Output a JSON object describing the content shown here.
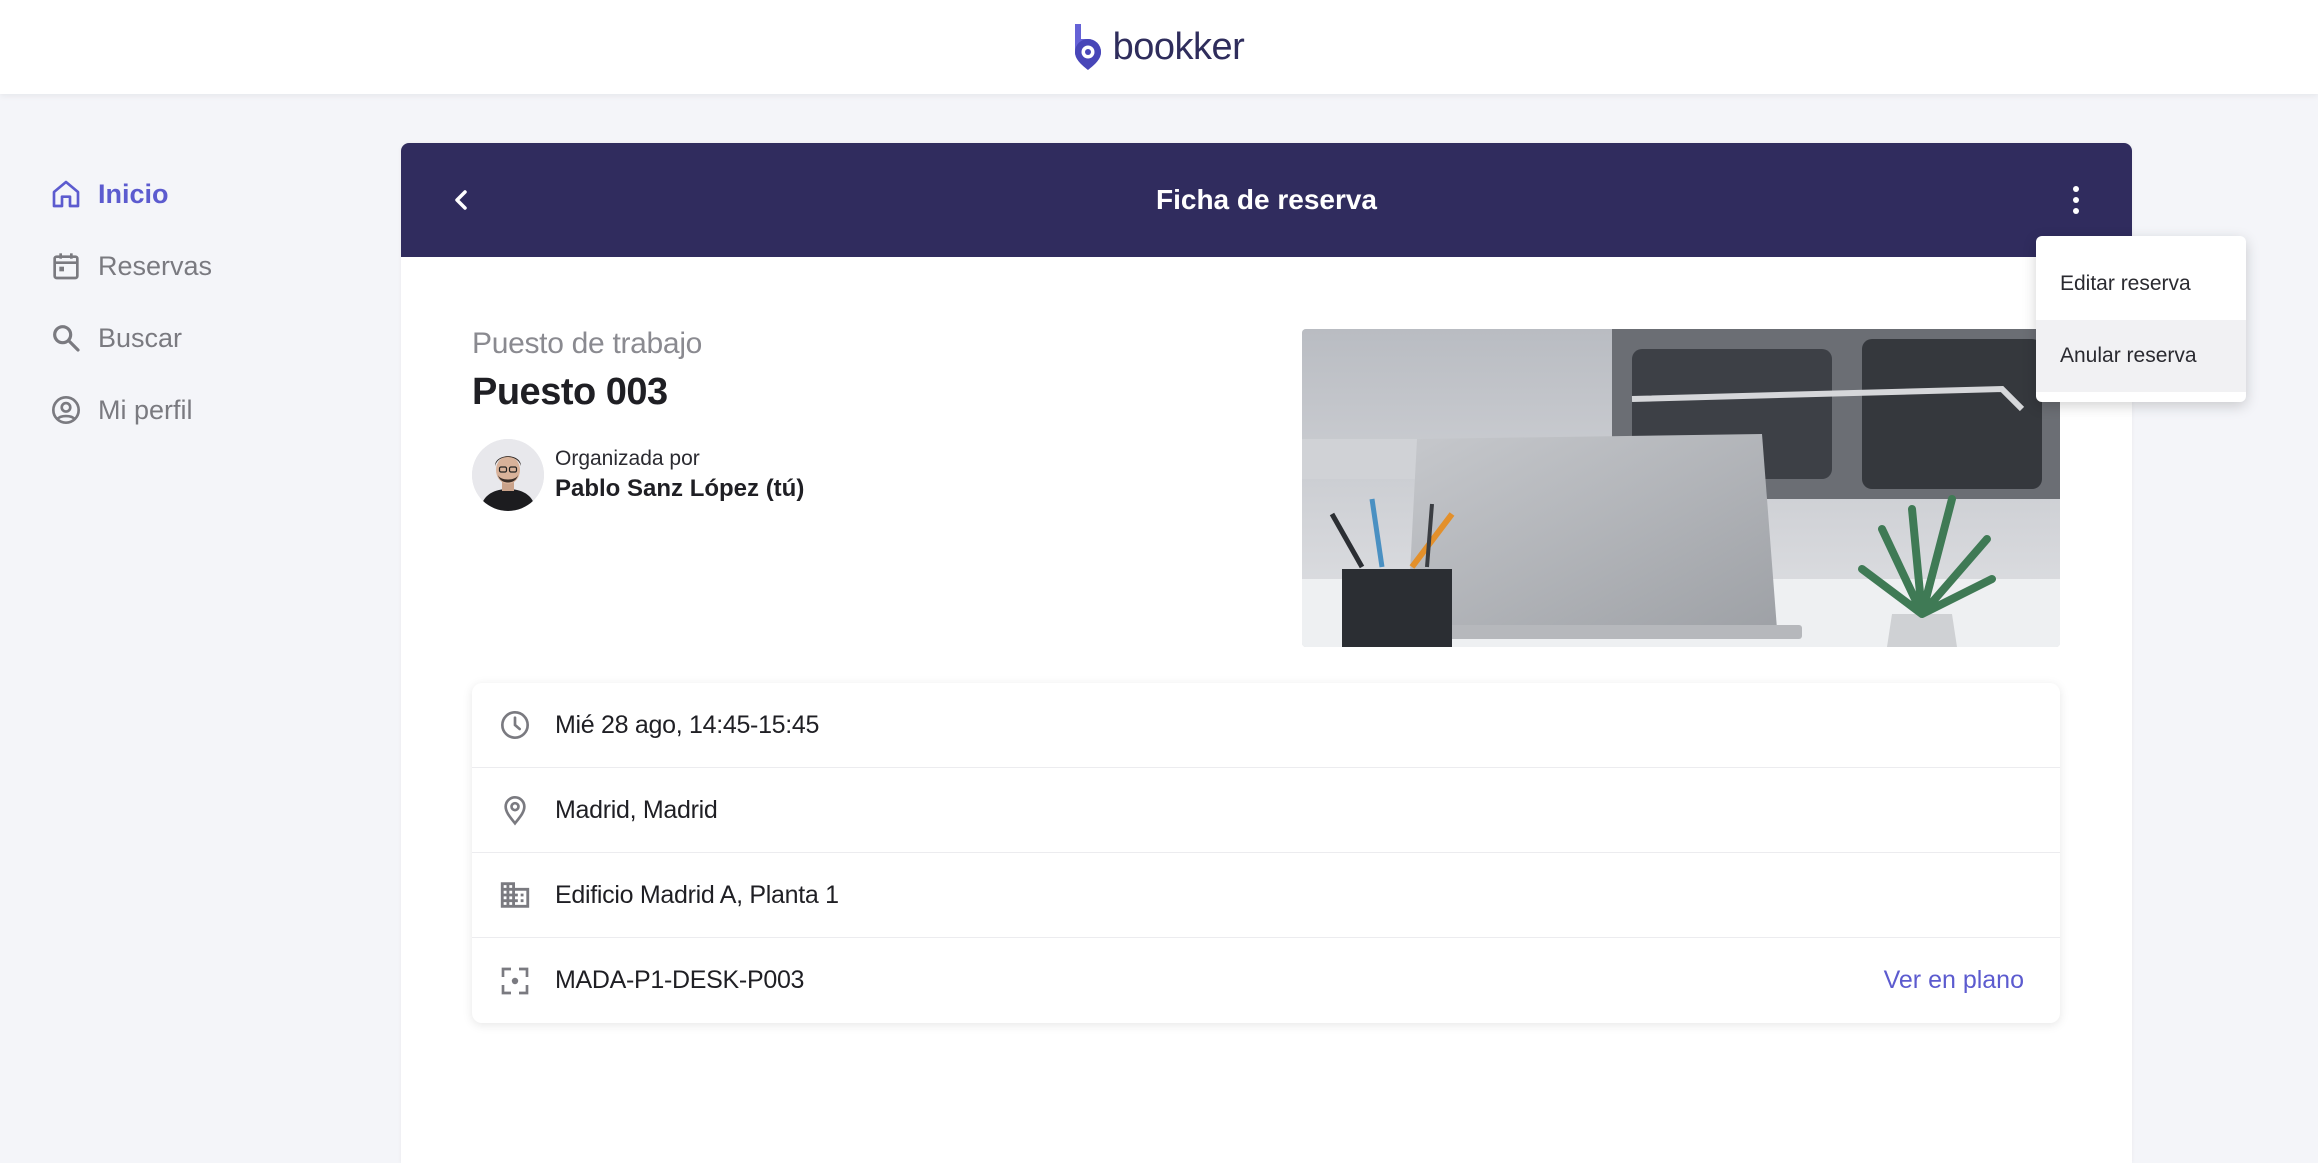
{
  "app": {
    "logo_text": "bookker"
  },
  "sidebar": {
    "items": [
      {
        "label": "Inicio",
        "icon": "home-icon",
        "active": true
      },
      {
        "label": "Reservas",
        "icon": "calendar-icon",
        "active": false
      },
      {
        "label": "Buscar",
        "icon": "search-icon",
        "active": false
      },
      {
        "label": "Mi perfil",
        "icon": "user-circle-icon",
        "active": false
      }
    ]
  },
  "header": {
    "title": "Ficha de reserva"
  },
  "reservation": {
    "type": "Puesto de trabajo",
    "name": "Puesto 003",
    "organizer_label": "Organizada por",
    "organizer_name": "Pablo Sanz López (tú)"
  },
  "details": {
    "datetime": "Mié 28 ago, 14:45-15:45",
    "city": "Madrid, Madrid",
    "building": "Edificio Madrid A, Planta 1",
    "code": "MADA-P1-DESK-P003",
    "map_link": "Ver en plano"
  },
  "menu": {
    "items": [
      {
        "label": "Editar reserva"
      },
      {
        "label": "Anular reserva"
      }
    ]
  },
  "colors": {
    "accent": "#5c5bcf",
    "header_bg": "#302c5e",
    "text_muted": "#7a7a80"
  }
}
